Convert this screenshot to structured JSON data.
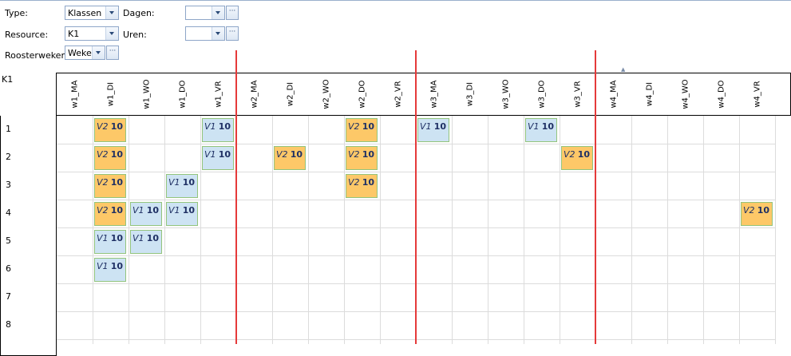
{
  "form": {
    "type_label": "Type:",
    "type_value": "Klassen",
    "dagen_label": "Dagen:",
    "dagen_value": "",
    "resource_label": "Resource:",
    "resource_value": "K1",
    "uren_label": "Uren:",
    "uren_value": "",
    "roosterweken_label": "Roosterweken:",
    "roosterweken_value": "Weker",
    "dots": "···"
  },
  "grid": {
    "corner_label": "K1",
    "columns": [
      "w1_MA",
      "w1_DI",
      "w1_WO",
      "w1_DO",
      "w1_VR",
      "w2_MA",
      "w2_DI",
      "w2_WO",
      "w2_DO",
      "w2_VR",
      "w3_MA",
      "w3_DI",
      "w3_WO",
      "w3_DO",
      "w3_VR",
      "w4_MA",
      "w4_DI",
      "w4_WO",
      "w4_DO",
      "w4_VR"
    ],
    "rows": [
      "1",
      "2",
      "3",
      "4",
      "5",
      "6",
      "7",
      "8"
    ],
    "cells": [
      {
        "row": 0,
        "col": 1,
        "code": "V2",
        "num": "10"
      },
      {
        "row": 0,
        "col": 4,
        "code": "V1",
        "num": "10"
      },
      {
        "row": 0,
        "col": 8,
        "code": "V2",
        "num": "10"
      },
      {
        "row": 0,
        "col": 10,
        "code": "V1",
        "num": "10"
      },
      {
        "row": 0,
        "col": 13,
        "code": "V1",
        "num": "10"
      },
      {
        "row": 1,
        "col": 1,
        "code": "V2",
        "num": "10"
      },
      {
        "row": 1,
        "col": 4,
        "code": "V1",
        "num": "10"
      },
      {
        "row": 1,
        "col": 6,
        "code": "V2",
        "num": "10"
      },
      {
        "row": 1,
        "col": 8,
        "code": "V2",
        "num": "10"
      },
      {
        "row": 1,
        "col": 14,
        "code": "V2",
        "num": "10"
      },
      {
        "row": 2,
        "col": 1,
        "code": "V2",
        "num": "10"
      },
      {
        "row": 2,
        "col": 3,
        "code": "V1",
        "num": "10"
      },
      {
        "row": 2,
        "col": 8,
        "code": "V2",
        "num": "10"
      },
      {
        "row": 3,
        "col": 1,
        "code": "V2",
        "num": "10"
      },
      {
        "row": 3,
        "col": 2,
        "code": "V1",
        "num": "10"
      },
      {
        "row": 3,
        "col": 3,
        "code": "V1",
        "num": "10"
      },
      {
        "row": 3,
        "col": 19,
        "code": "V2",
        "num": "10"
      },
      {
        "row": 4,
        "col": 1,
        "code": "V1",
        "num": "10"
      },
      {
        "row": 4,
        "col": 2,
        "code": "V1",
        "num": "10"
      },
      {
        "row": 5,
        "col": 1,
        "code": "V1",
        "num": "10"
      }
    ],
    "colors": {
      "V1": "#cde3f3",
      "V2": "#fdc868",
      "week_separator": "#e53a3a"
    }
  }
}
